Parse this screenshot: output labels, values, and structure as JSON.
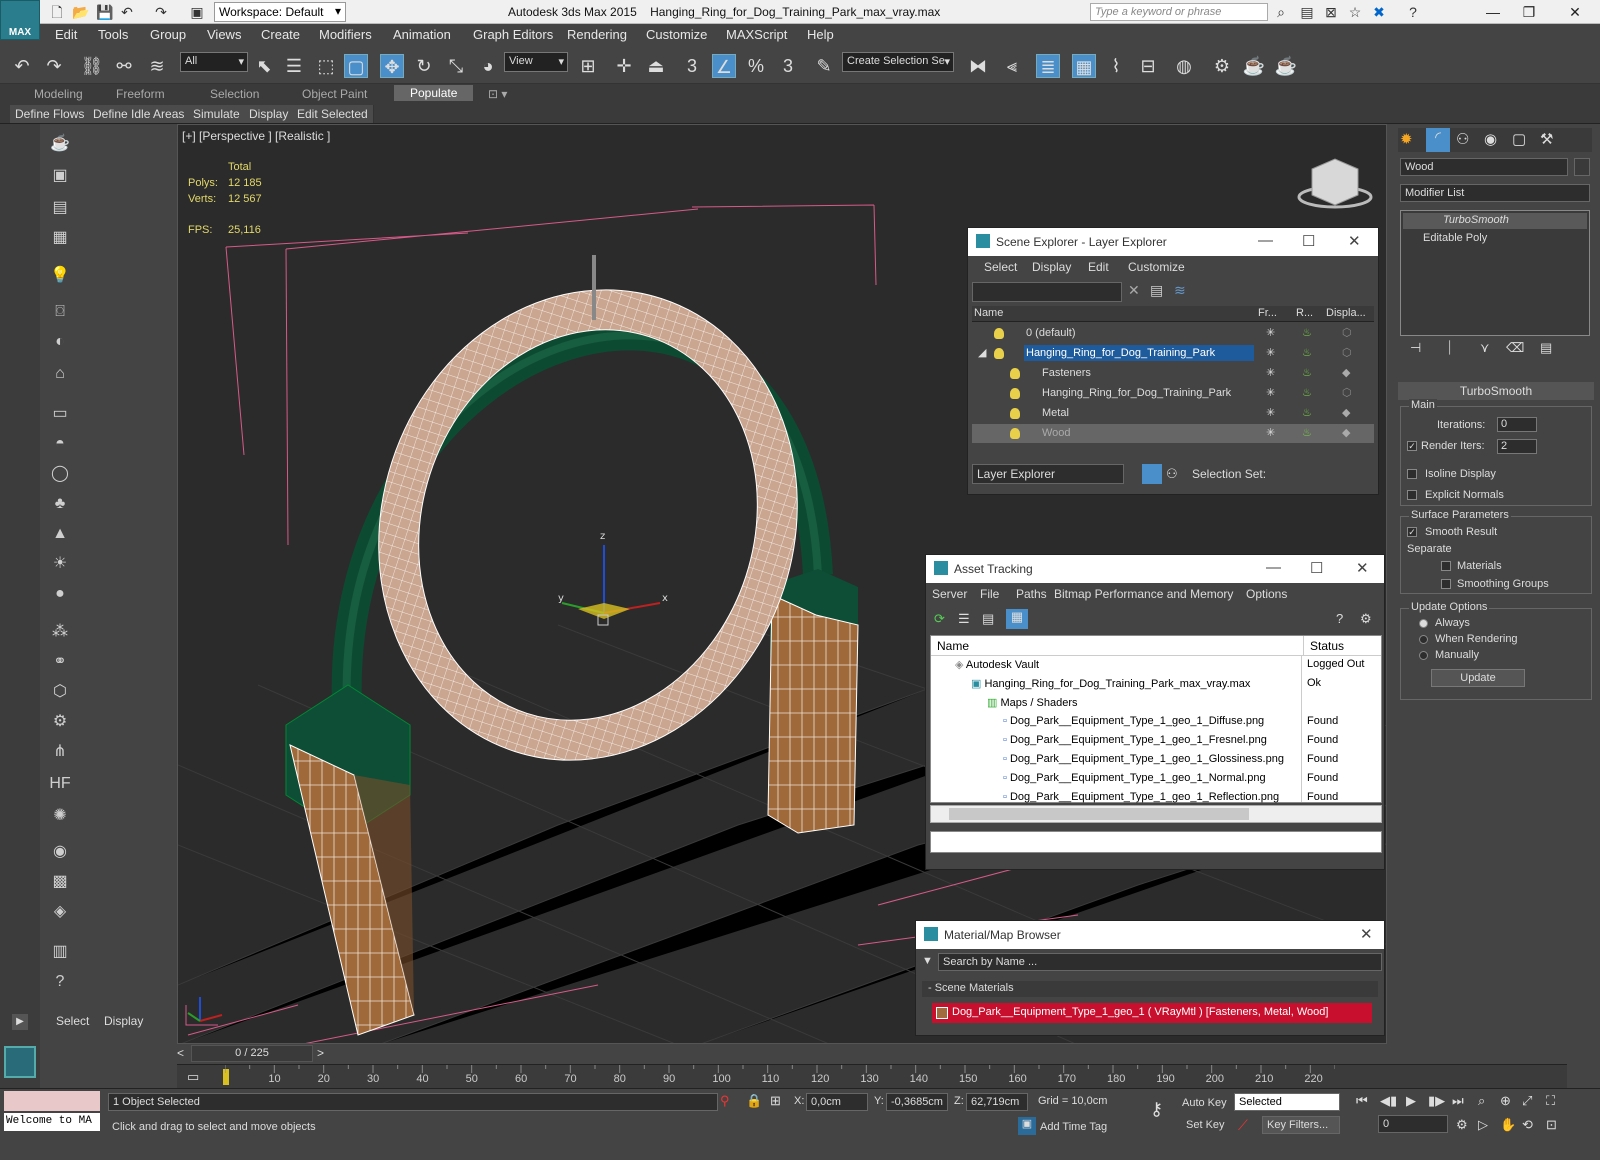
{
  "app": {
    "title": "Autodesk 3ds Max  2015",
    "file": "Hanging_Ring_for_Dog_Training_Park_max_vray.max",
    "logo": "MAX",
    "workspace": "Workspace: Default",
    "search_placeholder": "Type a keyword or phrase"
  },
  "menu": [
    "Edit",
    "Tools",
    "Group",
    "Views",
    "Create",
    "Modifiers",
    "Animation",
    "Graph Editors",
    "Rendering",
    "Customize",
    "MAXScript",
    "Help"
  ],
  "toolbar": {
    "selection_filter": "All",
    "ref_coord": "View",
    "named_selection": "Create Selection Se",
    "snap_num": "3",
    "angle_num": "%",
    "spinner_num": "3"
  },
  "ribbon_tabs": [
    "Modeling",
    "Freeform",
    "Selection",
    "Object Paint",
    "Populate"
  ],
  "populate_buttons": [
    "Define Flows",
    "Define Idle Areas",
    "Simulate",
    "Display",
    "Edit Selected"
  ],
  "viewport": {
    "label": "[+] [Perspective ] [Realistic ]",
    "stats_header": "Total",
    "polys_label": "Polys:",
    "polys": "12 185",
    "verts_label": "Verts:",
    "verts": "12 567",
    "fps_label": "FPS:",
    "fps": "25,116",
    "axis_x": "x",
    "axis_y": "y",
    "axis_z": "z"
  },
  "scene_explorer": {
    "title": "Scene Explorer - Layer Explorer",
    "menu": [
      "Select",
      "Display",
      "Edit",
      "Customize"
    ],
    "columns": [
      "Name",
      "Fr...",
      "R...",
      "Displa..."
    ],
    "rows": [
      {
        "name": "0 (default)"
      },
      {
        "name": "Hanging_Ring_for_Dog_Training_Park"
      },
      {
        "name": "Fasteners"
      },
      {
        "name": "Hanging_Ring_for_Dog_Training_Park"
      },
      {
        "name": "Metal"
      },
      {
        "name": "Wood"
      }
    ],
    "footer_dropdown": "Layer Explorer",
    "selection_set": "Selection Set:"
  },
  "asset_tracking": {
    "title": "Asset Tracking",
    "menu": [
      "Server",
      "File",
      "Paths",
      "Bitmap Performance and Memory",
      "Options"
    ],
    "col_name": "Name",
    "col_status": "Status",
    "rows": [
      {
        "name": "Autodesk Vault",
        "status": "Logged Out"
      },
      {
        "name": "Hanging_Ring_for_Dog_Training_Park_max_vray.max",
        "status": "Ok"
      },
      {
        "name": "Maps / Shaders",
        "status": ""
      },
      {
        "name": "Dog_Park__Equipment_Type_1_geo_1_Diffuse.png",
        "status": "Found"
      },
      {
        "name": "Dog_Park__Equipment_Type_1_geo_1_Fresnel.png",
        "status": "Found"
      },
      {
        "name": "Dog_Park__Equipment_Type_1_geo_1_Glossiness.png",
        "status": "Found"
      },
      {
        "name": "Dog_Park__Equipment_Type_1_geo_1_Normal.png",
        "status": "Found"
      },
      {
        "name": "Dog_Park__Equipment_Type_1_geo_1_Reflection.png",
        "status": "Found"
      }
    ]
  },
  "material_browser": {
    "title": "Material/Map Browser",
    "search_placeholder": "Search by Name ...",
    "section": "- Scene Materials",
    "material": "Dog_Park__Equipment_Type_1_geo_1  ( VRayMtl ) [Fasteners, Metal, Wood]"
  },
  "command_panel": {
    "object_name": "Wood",
    "modifier_list": "Modifier List",
    "stack": [
      "TurboSmooth",
      "Editable Poly"
    ],
    "rollout_title": "TurboSmooth",
    "main_label": "Main",
    "iterations_label": "Iterations:",
    "iterations": "0",
    "render_iters_label": "Render Iters:",
    "render_iters": "2",
    "isoline": "Isoline Display",
    "explicit_normals": "Explicit Normals",
    "surface_params": "Surface Parameters",
    "smooth_result": "Smooth Result",
    "separate": "Separate",
    "materials": "Materials",
    "smoothing_groups": "Smoothing Groups",
    "update_options": "Update Options",
    "always": "Always",
    "when_rendering": "When Rendering",
    "manually": "Manually",
    "update_button": "Update"
  },
  "left_panel": {
    "tab_select": "Select",
    "tab_display": "Display"
  },
  "timeline": {
    "frame": "0 / 225",
    "ticks": [
      "10",
      "20",
      "30",
      "40",
      "50",
      "60",
      "70",
      "80",
      "90",
      "100",
      "110",
      "120",
      "130",
      "140",
      "150",
      "160",
      "170",
      "180",
      "190",
      "200",
      "210",
      "220"
    ]
  },
  "status": {
    "maxscript": "Welcome to MA",
    "objects_selected": "1 Object Selected",
    "prompt": "Click and drag to select and move objects",
    "x_label": "X:",
    "x": "0,0cm",
    "y_label": "Y:",
    "y": "-0,3685cm",
    "z_label": "Z:",
    "z": "62,719cm",
    "grid": "Grid = 10,0cm",
    "auto_key": "Auto Key",
    "set_key": "Set Key",
    "key_mode": "Selected",
    "key_filters": "Key Filters...",
    "add_time_tag": "Add Time Tag",
    "frame_field": "0"
  }
}
